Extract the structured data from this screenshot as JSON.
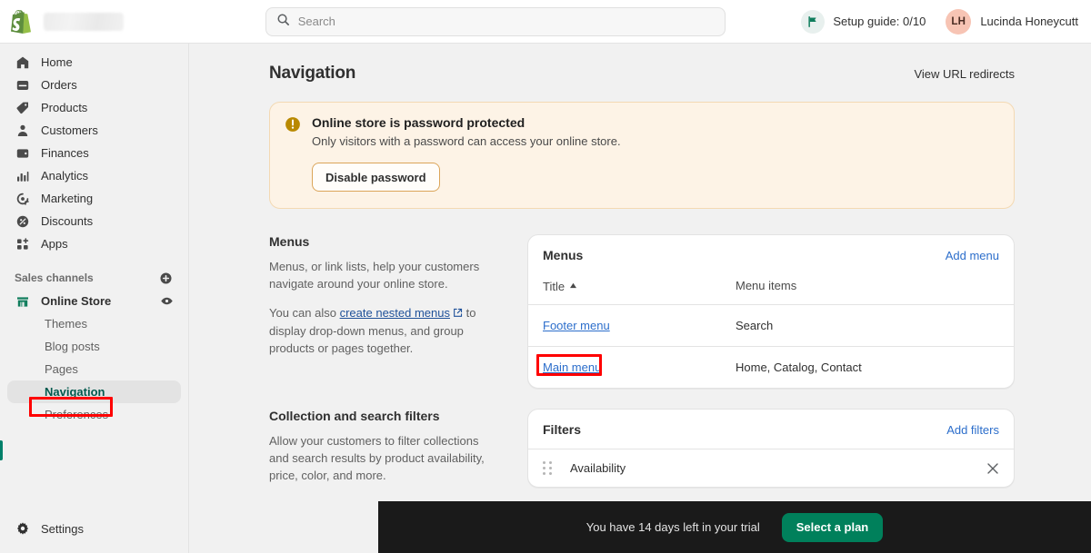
{
  "topbar": {
    "logo_icon": "shopify-logo",
    "store_name_redacted": "",
    "search": {
      "icon": "search-icon",
      "placeholder": "Search",
      "value": ""
    },
    "setup_guide": {
      "icon": "flag-icon",
      "label": "Setup guide: 0/10"
    },
    "user": {
      "initials": "LH",
      "name": "Lucinda Honeycutt"
    }
  },
  "sidebar": {
    "items": [
      {
        "label": "Home",
        "icon": "home-icon"
      },
      {
        "label": "Orders",
        "icon": "orders-inbox-icon"
      },
      {
        "label": "Products",
        "icon": "product-tag-icon"
      },
      {
        "label": "Customers",
        "icon": "person-icon"
      },
      {
        "label": "Finances",
        "icon": "wallet-icon"
      },
      {
        "label": "Analytics",
        "icon": "bar-chart-icon"
      },
      {
        "label": "Marketing",
        "icon": "megaphone-target-icon"
      },
      {
        "label": "Discounts",
        "icon": "discount-percent-icon"
      },
      {
        "label": "Apps",
        "icon": "apps-grid-plus-icon"
      }
    ],
    "sales_channels": {
      "title": "Sales channels",
      "add_icon": "plus-circle-icon",
      "channel": {
        "label": "Online Store",
        "icon": "storefront-icon",
        "view_icon": "eye-icon"
      },
      "sub_items": [
        {
          "label": "Themes",
          "active": false
        },
        {
          "label": "Blog posts",
          "active": false
        },
        {
          "label": "Pages",
          "active": false
        },
        {
          "label": "Navigation",
          "active": true
        },
        {
          "label": "Preferences",
          "active": false
        }
      ]
    },
    "settings": {
      "label": "Settings",
      "icon": "gear-icon"
    }
  },
  "page": {
    "title": "Navigation",
    "header_link": "View URL redirects"
  },
  "banner": {
    "icon": "alert-circle-icon",
    "title": "Online store is password protected",
    "description": "Only visitors with a password can access your online store.",
    "button": "Disable password"
  },
  "menus_section": {
    "heading": "Menus",
    "paragraph1": "Menus, or link lists, help your customers navigate around your online store.",
    "paragraph2_before": "You can also ",
    "paragraph2_link": "create nested menus",
    "link_icon": "external-link-icon",
    "paragraph2_after": " to display drop-down menus, and group products or pages together.",
    "card": {
      "title": "Menus",
      "action": "Add menu",
      "columns": {
        "title": "Title",
        "sort_indicator": "▲",
        "items": "Menu items"
      },
      "rows": [
        {
          "title": "Footer menu",
          "items": "Search"
        },
        {
          "title": "Main menu",
          "items": "Home, Catalog, Contact"
        }
      ]
    }
  },
  "filters_section": {
    "heading": "Collection and search filters",
    "paragraph": "Allow your customers to filter collections and search results by product availability, price, color, and more.",
    "card": {
      "title": "Filters",
      "action": "Add filters",
      "rows": [
        {
          "name": "Availability",
          "drag_icon": "drag-handle-icon",
          "remove_icon": "close-icon"
        }
      ]
    }
  },
  "trial": {
    "text": "You have 14 days left in your trial",
    "button": "Select a plan"
  },
  "colors": {
    "accent_green": "#00805b",
    "active_green": "#005a4e",
    "link_blue": "#2c6ecb",
    "warning_bg": "#fdf3e6",
    "warning_border": "#f3d9b3",
    "annotation_red": "#ff0000",
    "avatar_bg": "#f7c4b4",
    "trial_bg": "#1a1a1a"
  }
}
